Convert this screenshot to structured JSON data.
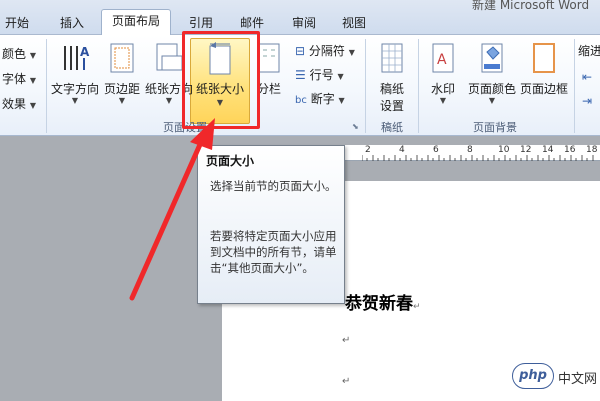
{
  "window": {
    "title_fragment": "新建 Microsoft Word"
  },
  "tabs": [
    {
      "label": "开始"
    },
    {
      "label": "插入"
    },
    {
      "label": "页面布局"
    },
    {
      "label": "引用"
    },
    {
      "label": "邮件"
    },
    {
      "label": "审阅"
    },
    {
      "label": "视图"
    }
  ],
  "ribbon": {
    "theme": {
      "colors": "颜色",
      "fonts": "字体",
      "effects": "效果"
    },
    "page_setup": {
      "text_direction": "文字方向",
      "margins": "页边距",
      "orientation": "纸张方向",
      "size": "纸张大小",
      "columns": "分栏",
      "breaks": "分隔符",
      "line_numbers": "行号",
      "hyphenation": "断字",
      "group_label": "页面设置"
    },
    "manuscript": {
      "button": "稿纸设置",
      "button_line1": "稿纸",
      "button_line2": "设置",
      "group_label": "稿纸"
    },
    "background": {
      "watermark": "水印",
      "page_color": "页面颜色",
      "page_borders": "页面边框",
      "group_label": "页面背景"
    },
    "right_cut": "缩进"
  },
  "tooltip": {
    "title": "页面大小",
    "line1": "选择当前节的页面大小。",
    "line2": "若要将特定页面大小应用到文档中的所有节，请单击“其他页面大小”。"
  },
  "ruler": {
    "ticks": [
      "2",
      "4",
      "6",
      "8",
      "10",
      "12",
      "14",
      "16",
      "18"
    ]
  },
  "document": {
    "heading": "恭贺新春",
    "para_mark": "↵"
  },
  "watermark": {
    "logo": "php",
    "site": "中文网"
  },
  "colors": {
    "highlight": "#ffd45a",
    "annotation_red": "#f0282a"
  }
}
